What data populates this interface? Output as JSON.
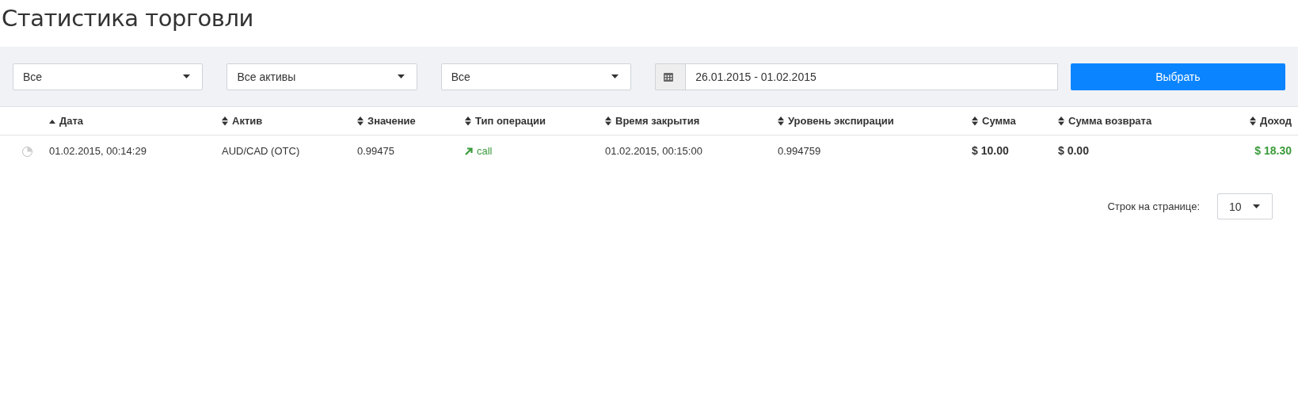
{
  "title": "Статистика торговли",
  "filters": [
    {
      "kind": "select",
      "value": "Все"
    },
    {
      "kind": "select",
      "value": "Все активы"
    },
    {
      "kind": "select",
      "value": "Все"
    },
    {
      "kind": "daterange",
      "value": "26.01.2015 - 01.02.2015"
    }
  ],
  "apply_button": "Выбрать",
  "table": {
    "columns": [
      {
        "label": "Дата",
        "sorted": true
      },
      {
        "label": "Актив",
        "sorted": false
      },
      {
        "label": "Значение",
        "sorted": false
      },
      {
        "label": "Тип операции",
        "sorted": false
      },
      {
        "label": "Время закрытия",
        "sorted": false
      },
      {
        "label": "Уровень экспирации",
        "sorted": false
      },
      {
        "label": "Сумма",
        "sorted": false
      },
      {
        "label": "Сумма возврата",
        "sorted": false
      },
      {
        "label": "Доход",
        "sorted": false
      }
    ],
    "rows": [
      {
        "closed": true,
        "date": "01.02.2015, 00:14:29",
        "asset": "AUD/CAD (OTC)",
        "value": "0.99475",
        "operation": {
          "rising": true,
          "label": "call"
        },
        "close_time": "01.02.2015, 00:15:00",
        "expiry_level": "0.994759",
        "amount": "$ 10.00",
        "refund": "$ 0.00",
        "income": "$ 18.30",
        "income_positive": true
      }
    ]
  },
  "pagination": {
    "label": "Строк на странице:",
    "value": "10"
  }
}
